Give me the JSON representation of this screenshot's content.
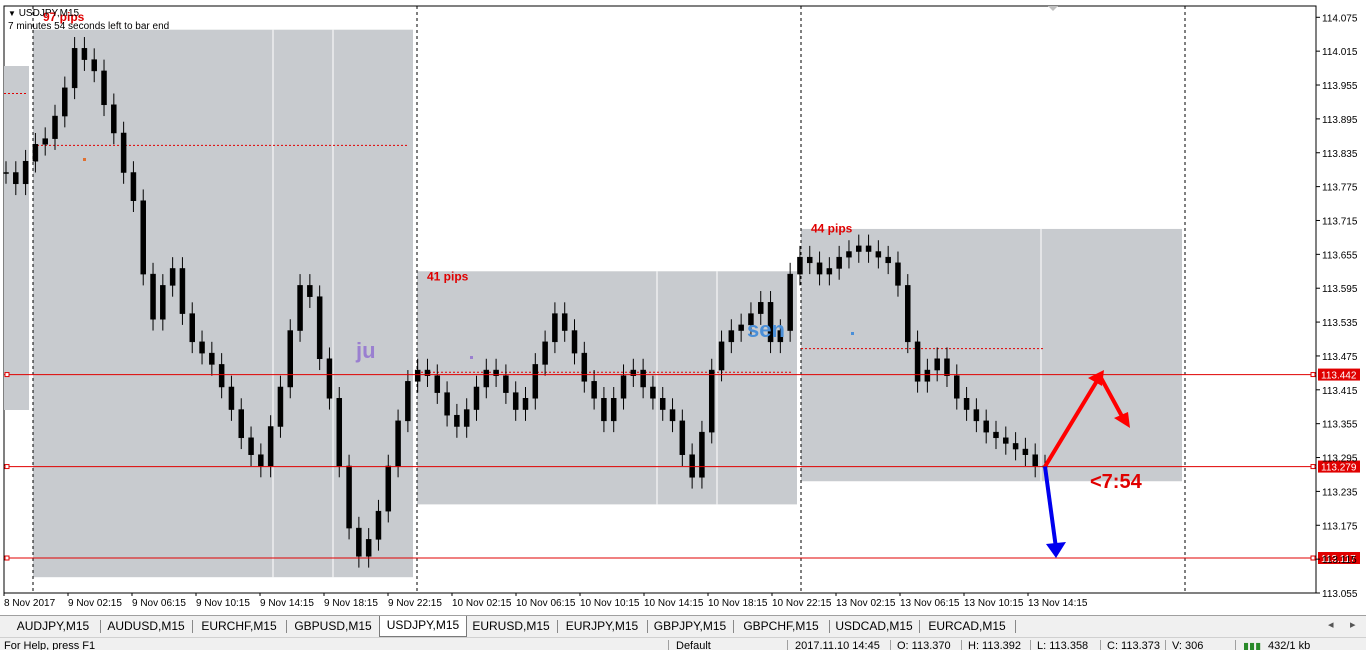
{
  "header": {
    "symbol_line": "USDJPY,M15",
    "timer_line": "7 minutes 54 seconds left to bar end"
  },
  "chart_data": {
    "type": "candlestick",
    "symbol": "USDJPY",
    "timeframe": "M15",
    "ylim": [
      113.055,
      114.095
    ],
    "y_ticks": [
      "114.075",
      "114.015",
      "113.955",
      "113.895",
      "113.835",
      "113.775",
      "113.715",
      "113.655",
      "113.595",
      "113.535",
      "113.475",
      "113.415",
      "113.355",
      "113.295",
      "113.235",
      "113.175",
      "113.115",
      "113.055"
    ],
    "x_ticks": [
      "8 Nov 2017",
      "9 Nov 02:15",
      "9 Nov 06:15",
      "9 Nov 10:15",
      "9 Nov 14:15",
      "9 Nov 18:15",
      "9 Nov 22:15",
      "10 Nov 02:15",
      "10 Nov 06:15",
      "10 Nov 10:15",
      "10 Nov 14:15",
      "10 Nov 18:15",
      "10 Nov 22:15",
      "13 Nov 02:15",
      "13 Nov 06:15",
      "13 Nov 10:15",
      "13 Nov 14:15"
    ],
    "closes": [
      113.8,
      113.78,
      113.82,
      113.85,
      113.86,
      113.9,
      113.95,
      114.02,
      114.0,
      113.98,
      113.92,
      113.87,
      113.8,
      113.75,
      113.62,
      113.54,
      113.6,
      113.63,
      113.55,
      113.5,
      113.48,
      113.46,
      113.42,
      113.38,
      113.33,
      113.3,
      113.28,
      113.35,
      113.42,
      113.52,
      113.6,
      113.58,
      113.47,
      113.4,
      113.28,
      113.17,
      113.12,
      113.15,
      113.2,
      113.28,
      113.36,
      113.43,
      113.45,
      113.44,
      113.41,
      113.37,
      113.35,
      113.38,
      113.42,
      113.45,
      113.44,
      113.41,
      113.38,
      113.4,
      113.46,
      113.5,
      113.55,
      113.52,
      113.48,
      113.43,
      113.4,
      113.36,
      113.4,
      113.44,
      113.45,
      113.42,
      113.4,
      113.38,
      113.36,
      113.3,
      113.26,
      113.34,
      113.45,
      113.5,
      113.52,
      113.53,
      113.55,
      113.57,
      113.5,
      113.52,
      113.62,
      113.65,
      113.64,
      113.62,
      113.63,
      113.65,
      113.66,
      113.67,
      113.66,
      113.65,
      113.64,
      113.6,
      113.5,
      113.43,
      113.45,
      113.47,
      113.44,
      113.4,
      113.38,
      113.36,
      113.34,
      113.33,
      113.32,
      113.31,
      113.3,
      113.28,
      113.28
    ],
    "boxes": [
      {
        "label": "97 pips",
        "hi": 114.053,
        "lo": 113.083
      },
      {
        "label": "41 pips",
        "hi": 113.625,
        "lo": 113.212
      },
      {
        "label": "44 pips",
        "hi": 113.7,
        "lo": 113.253
      }
    ],
    "levels": [
      {
        "price": 113.442,
        "label": "113.442"
      },
      {
        "price": 113.279,
        "label": "113.279"
      },
      {
        "price": 113.117,
        "label": "113.117"
      }
    ],
    "session_labels": [
      "ju",
      "sen"
    ],
    "countdown": "<7:54",
    "colors": {
      "bull": "#000000",
      "bear": "#000000",
      "box": "#c8cbcf",
      "level": "#e00000",
      "level_tag_bg": "#e00000",
      "pips_text": "#e00000",
      "ju_text": "#9a7fd0",
      "sen_text": "#4a8fd8",
      "arrow_up": "#ff0000",
      "arrow_down": "#0000ee"
    }
  },
  "tabs": [
    {
      "label": "AUDJPY,M15",
      "active": false
    },
    {
      "label": "AUDUSD,M15",
      "active": false
    },
    {
      "label": "EURCHF,M15",
      "active": false
    },
    {
      "label": "GBPUSD,M15",
      "active": false
    },
    {
      "label": "USDJPY,M15",
      "active": true
    },
    {
      "label": "EURUSD,M15",
      "active": false
    },
    {
      "label": "EURJPY,M15",
      "active": false
    },
    {
      "label": "GBPJPY,M15",
      "active": false
    },
    {
      "label": "GBPCHF,M15",
      "active": false
    },
    {
      "label": "USDCAD,M15",
      "active": false
    },
    {
      "label": "EURCAD,M15",
      "active": false
    }
  ],
  "status": {
    "help": "For Help, press F1",
    "profile": "Default",
    "datetime": "2017.11.10 14:45",
    "open": "O: 113.370",
    "high": "H: 113.392",
    "low": "L: 113.358",
    "close": "C: 113.373",
    "volume": "V: 306",
    "traffic": "432/1 kb"
  }
}
